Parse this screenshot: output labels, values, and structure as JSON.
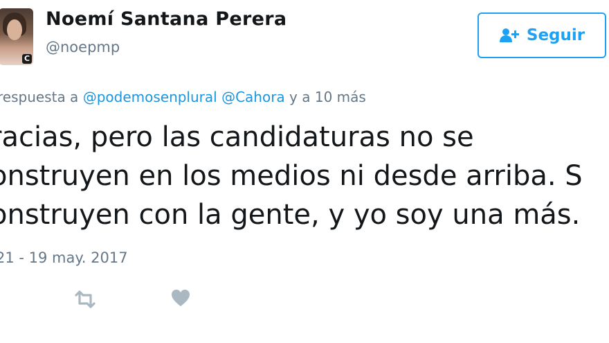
{
  "user": {
    "name": "Noemí Santana Perera",
    "handle": "@noepmp",
    "avatar_badge": "C"
  },
  "follow_button": {
    "label": "Seguir",
    "icon": "add-user-icon"
  },
  "reply": {
    "prefix": "respuesta a",
    "mention_1": "@podemosenplural",
    "mention_2": "@Cahora",
    "suffix": "y a 10 más"
  },
  "tweet": {
    "line_1": "racias, pero las candidaturas no se",
    "line_2": "onstruyen en los medios ni desde arriba. S",
    "line_3": "onstruyen con la gente, y yo soy una más."
  },
  "timestamp": "21 - 19 may. 2017",
  "actions": {
    "retweet_icon": "retweet-icon",
    "like_icon": "heart-icon"
  },
  "colors": {
    "accent": "#1da1f2",
    "link": "#1b95e0",
    "muted": "#657786",
    "icon_gray": "#aab8c2"
  }
}
